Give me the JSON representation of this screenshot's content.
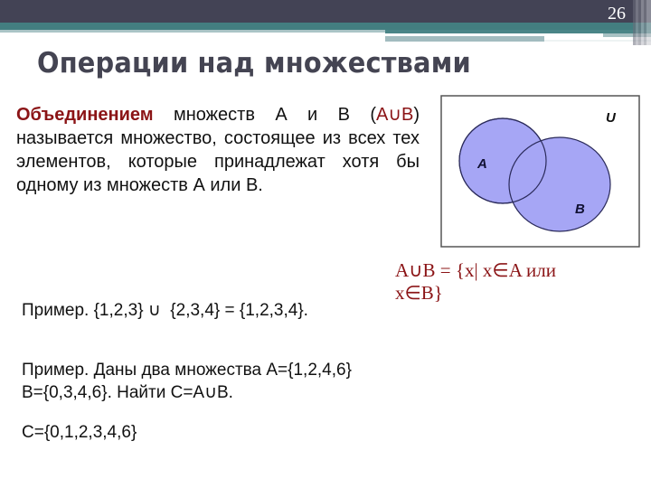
{
  "slide": {
    "number": "26",
    "title": "Операции над множествами"
  },
  "definition": {
    "term": "Объединением",
    "text_before_symbol": " множеств  А и В (",
    "symbol": "A∪B",
    "text_after_symbol": ") называется множество, состоящее из всех тех элементов, которые принадлежат хотя бы одному из множеств  А или В."
  },
  "venn_diagram": {
    "universe_label": "U",
    "set_a_label": "A",
    "set_b_label": "B",
    "fill_color": "#a6a6f5",
    "stroke_color": "#2a2a5a"
  },
  "formula": {
    "line1": "A∪B = {x| x∈A или",
    "line2": "x∈B}"
  },
  "examples": {
    "example1": "Пример. {1,2,3} ∪  {2,3,4} = {1,2,3,4}.",
    "example2_line1": "Пример. Даны два множества A={1,2,4,6}",
    "example2_line2": "B={0,3,4,6}. Найти C=A∪B.",
    "answer": "C={0,1,2,3,4,6}"
  },
  "colors": {
    "header_dark": "#434355",
    "header_teal": "#437e80",
    "accent_red": "#8b1416",
    "title_color": "#444452"
  }
}
